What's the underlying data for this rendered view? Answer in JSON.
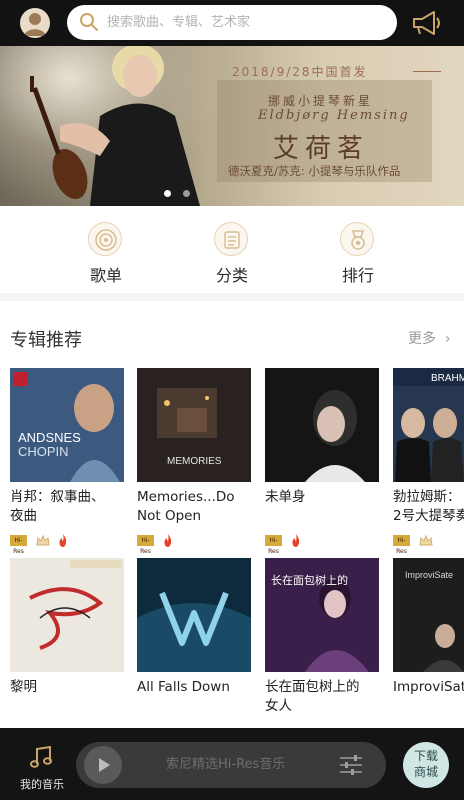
{
  "header": {
    "search_placeholder": "搜索歌曲、专辑、艺术家"
  },
  "banner": {
    "date_text": "2018/9/28中国首发",
    "subtitle": "挪威小提琴新星",
    "artist_latin": "Eldbjørg Hemsing",
    "artist_cn": "艾荷茗",
    "description": "德沃夏克/苏克: 小提琴与乐队作品",
    "active_dot": 0,
    "dot_count": 2
  },
  "categories": [
    {
      "label": "歌单",
      "icon": "playlist-icon"
    },
    {
      "label": "分类",
      "icon": "category-icon"
    },
    {
      "label": "排行",
      "icon": "ranking-icon"
    }
  ],
  "section": {
    "title": "专辑推荐",
    "more_label": "更多"
  },
  "albums": [
    {
      "title": "肖邦：叙事曲、\n夜曲",
      "badges": [
        "hires",
        "crown",
        "fire"
      ],
      "cover_text": "ANDSNES\nCHOPIN"
    },
    {
      "title": "Memories...Do\nNot Open",
      "badges": [
        "hires",
        "fire"
      ],
      "cover_text": "MEMORIES"
    },
    {
      "title": "未单身",
      "badges": [
        "hires",
        "fire"
      ],
      "cover_text": ""
    },
    {
      "title": "勃拉姆斯：\n2号大提琴奏",
      "badges": [
        "hires",
        "crown"
      ],
      "cover_text": "BRAHMS"
    },
    {
      "title": "黎明",
      "badges": [],
      "cover_text": ""
    },
    {
      "title": "All Falls Down",
      "badges": [],
      "cover_text": ""
    },
    {
      "title": "长在面包树上的\n女人",
      "badges": [
        "hires"
      ],
      "cover_text": "长在面包树上的女人"
    },
    {
      "title": "ImproviSat",
      "badges": [
        "hires"
      ],
      "cover_text": "ImproviSate"
    }
  ],
  "bottom_bar": {
    "my_music_label": "我的音乐",
    "player_text": "索尼精选Hi-Res音乐",
    "shop_label_line1": "下载",
    "shop_label_line2": "商城"
  },
  "badge_text": {
    "hires": "Hi-Res"
  },
  "colors": {
    "header_bg": "#121212",
    "accent_gold": "#c9a56a",
    "banner_text": "#6b4b38",
    "fire": "#e2452c",
    "shop_bg": "#cfe6e4"
  }
}
